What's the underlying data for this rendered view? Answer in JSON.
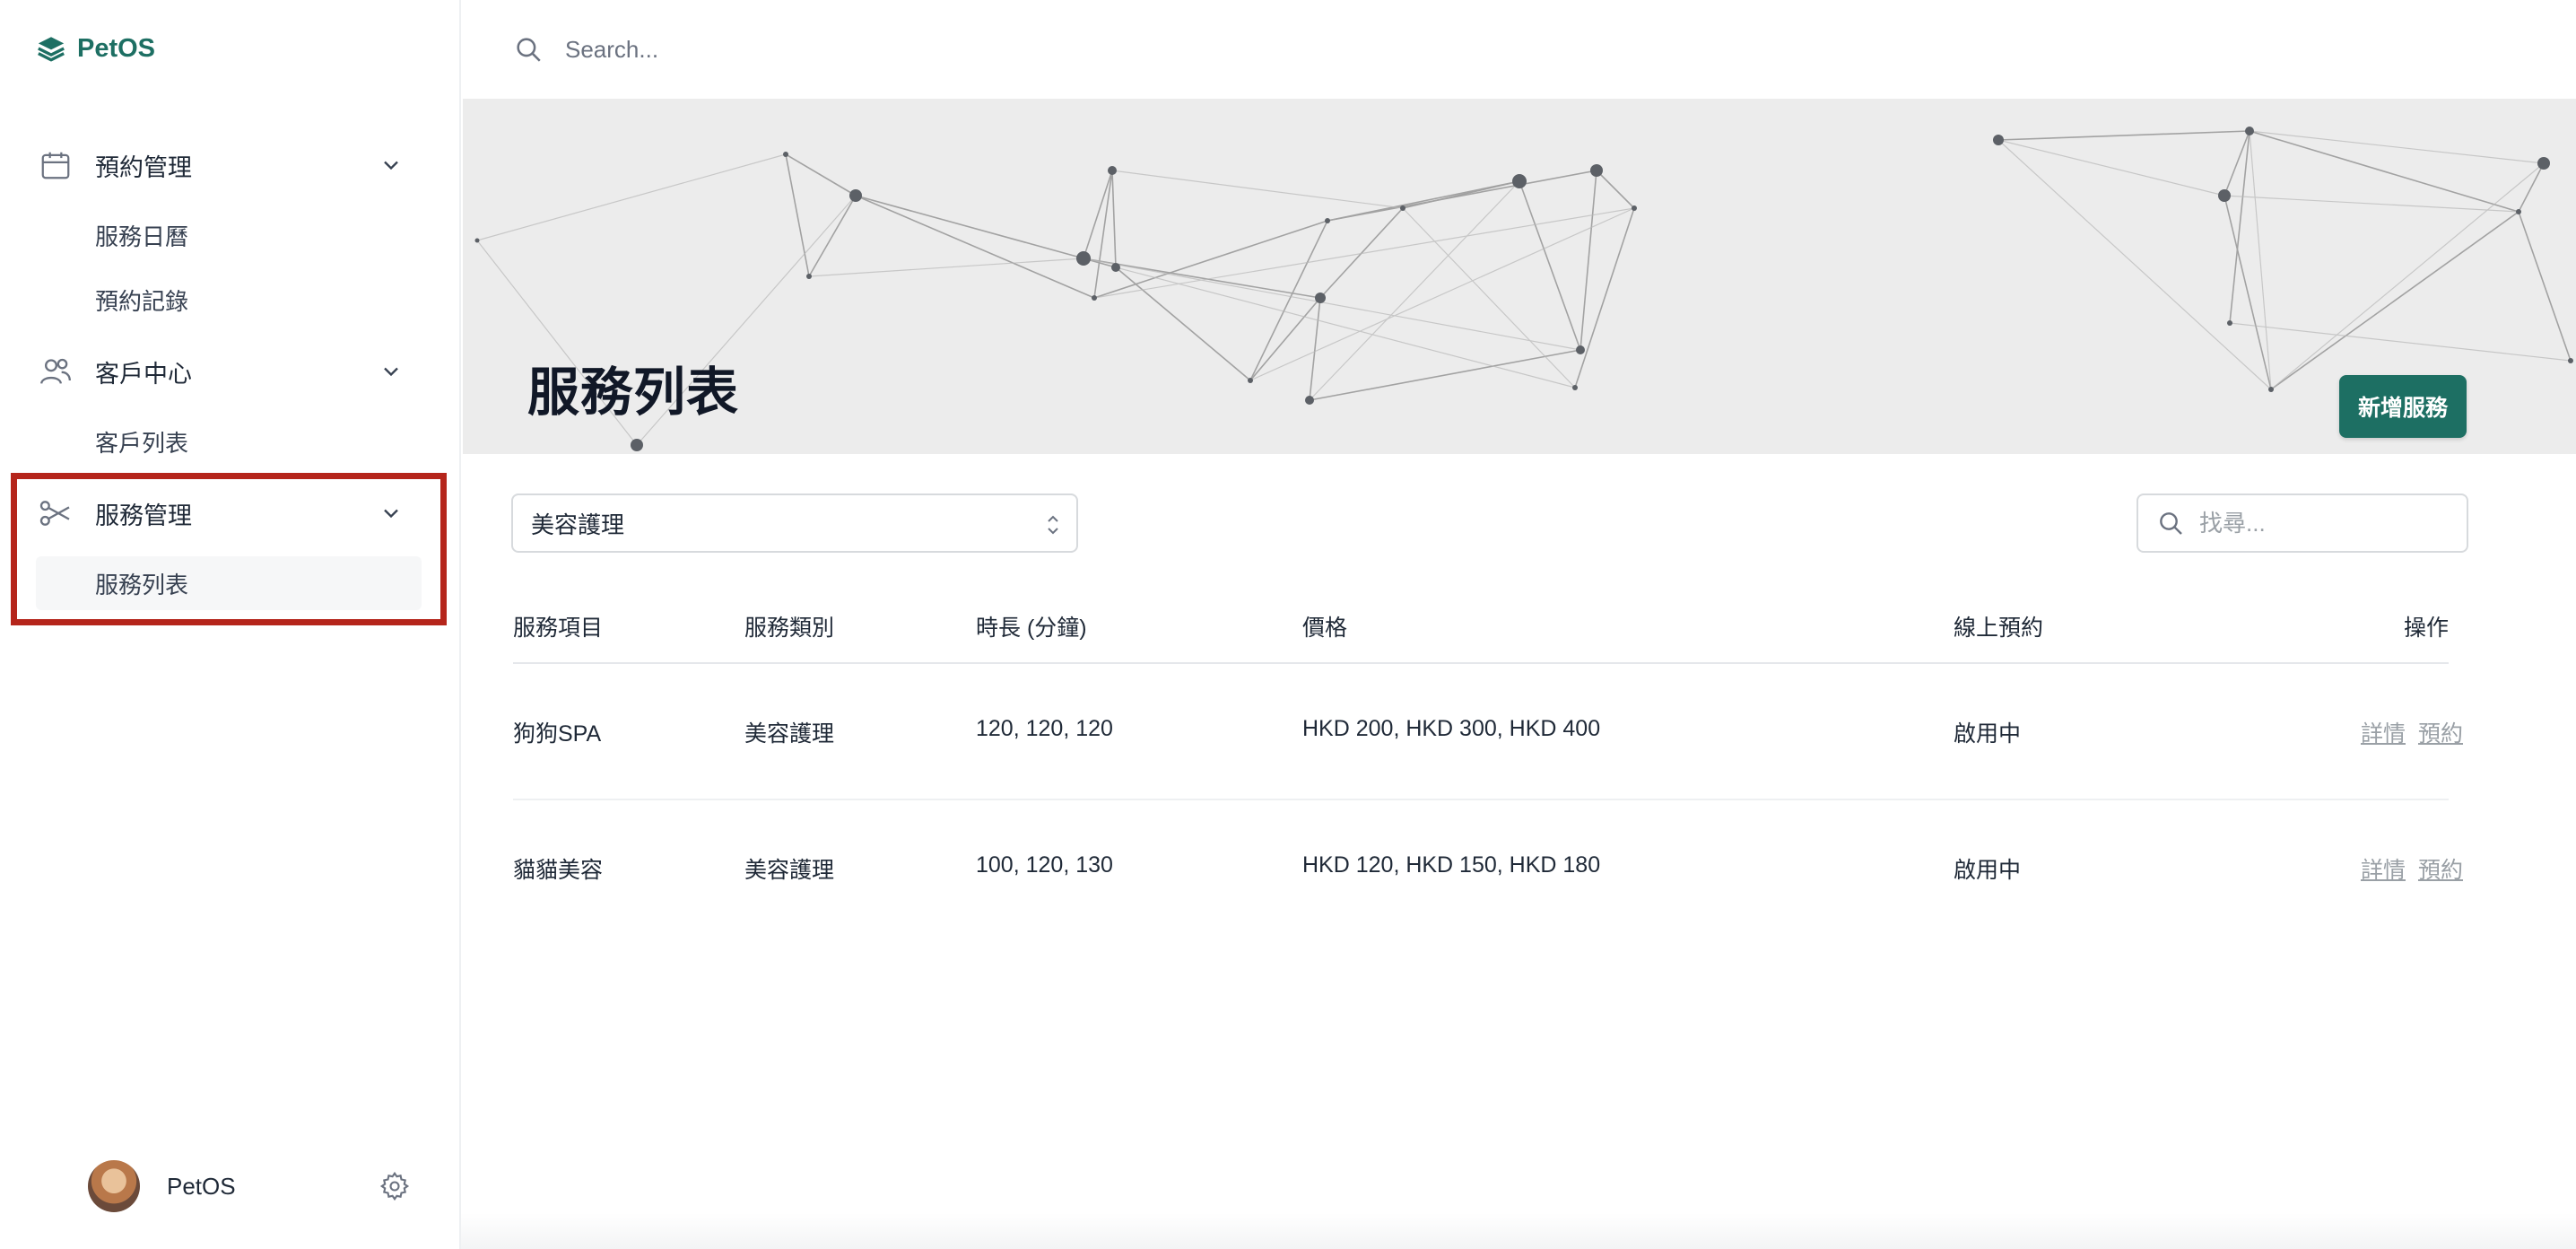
{
  "brand": {
    "name": "PetOS"
  },
  "sidebar": {
    "groups": [
      {
        "label": "預約管理",
        "icon": "calendar-icon",
        "items": [
          {
            "label": "服務日曆"
          },
          {
            "label": "預約記錄"
          }
        ]
      },
      {
        "label": "客戶中心",
        "icon": "users-icon",
        "items": [
          {
            "label": "客戶列表"
          }
        ]
      },
      {
        "label": "服務管理",
        "icon": "scissors-icon",
        "items": [
          {
            "label": "服務列表",
            "active": true
          }
        ]
      }
    ],
    "user": {
      "name": "PetOS"
    }
  },
  "topbar": {
    "search_placeholder": "Search..."
  },
  "page": {
    "title": "服務列表",
    "add_button": "新增服務"
  },
  "filters": {
    "category_selected": "美容護理",
    "find_placeholder": "找尋..."
  },
  "table": {
    "headers": [
      "服務項目",
      "服務類別",
      "時長 (分鐘)",
      "價格",
      "線上預約",
      "操作"
    ],
    "rows": [
      {
        "name": "狗狗SPA",
        "category": "美容護理",
        "duration": "120, 120, 120",
        "price": "HKD 200, HKD 300, HKD 400",
        "online": "啟用中",
        "detail": "詳情",
        "book": "預約"
      },
      {
        "name": "貓貓美容",
        "category": "美容護理",
        "duration": "100, 120, 130",
        "price": "HKD 120, HKD 150, HKD 180",
        "online": "啟用中",
        "detail": "詳情",
        "book": "預約"
      }
    ]
  },
  "colors": {
    "accent": "#1d6f63",
    "highlight": "#b5251b",
    "hero_bg": "#ececec"
  }
}
